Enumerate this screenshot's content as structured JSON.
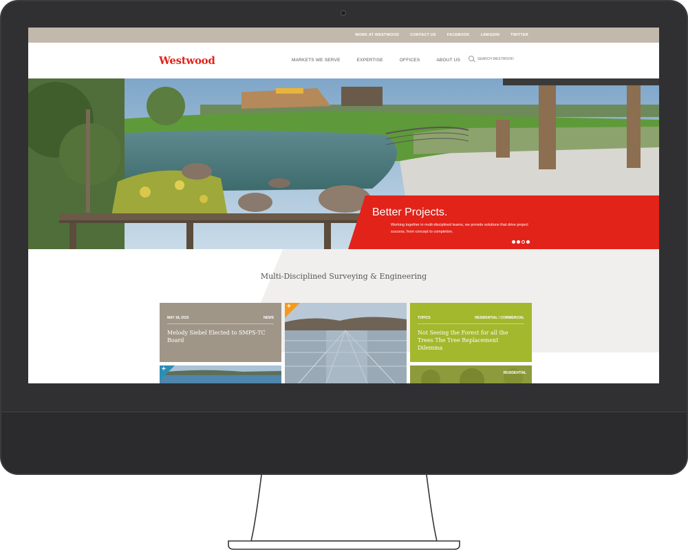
{
  "utility_nav": [
    "WORK AT WESTWOOD",
    "CONTACT US",
    "FACEBOOK",
    "LINKEDIN",
    "TWITTER"
  ],
  "header": {
    "logo": "Westwood",
    "nav": [
      "MARKETS WE SERVE",
      "EXPERTISE",
      "OFFICES",
      "ABOUT US"
    ],
    "search_placeholder": "SEARCH WESTWOOD"
  },
  "hero": {
    "title": "Better Projects.",
    "text": "Working together in multi-disciplined teams, we provide solutions that drive project success, from concept to completion.",
    "slide_count": 4,
    "active_slide": 3
  },
  "tagline": "Multi-Disciplined Surveying & Engineering",
  "cards": {
    "news": {
      "date": "MAY 18, 2015",
      "category": "NEWS",
      "title": "Melody Siebel Elected to SMPS-TC Board"
    },
    "solar": {
      "plus": "+"
    },
    "topics": {
      "label": "TOPICS",
      "category": "RESIDENTIAL / COMMERCIAL",
      "title": "Not Seeing the Forest for all the Trees The Tree Replacement Dilemma"
    },
    "lake": {
      "plus": "+"
    },
    "residential": {
      "label": "RESIDENTIAL"
    }
  },
  "colors": {
    "brand_red": "#e2231a",
    "utility_bar": "#c2b8ac",
    "news_card": "#a09688",
    "topics_card": "#a3b82c",
    "plus_orange": "#f39a1e",
    "plus_teal": "#2a8fb5"
  }
}
